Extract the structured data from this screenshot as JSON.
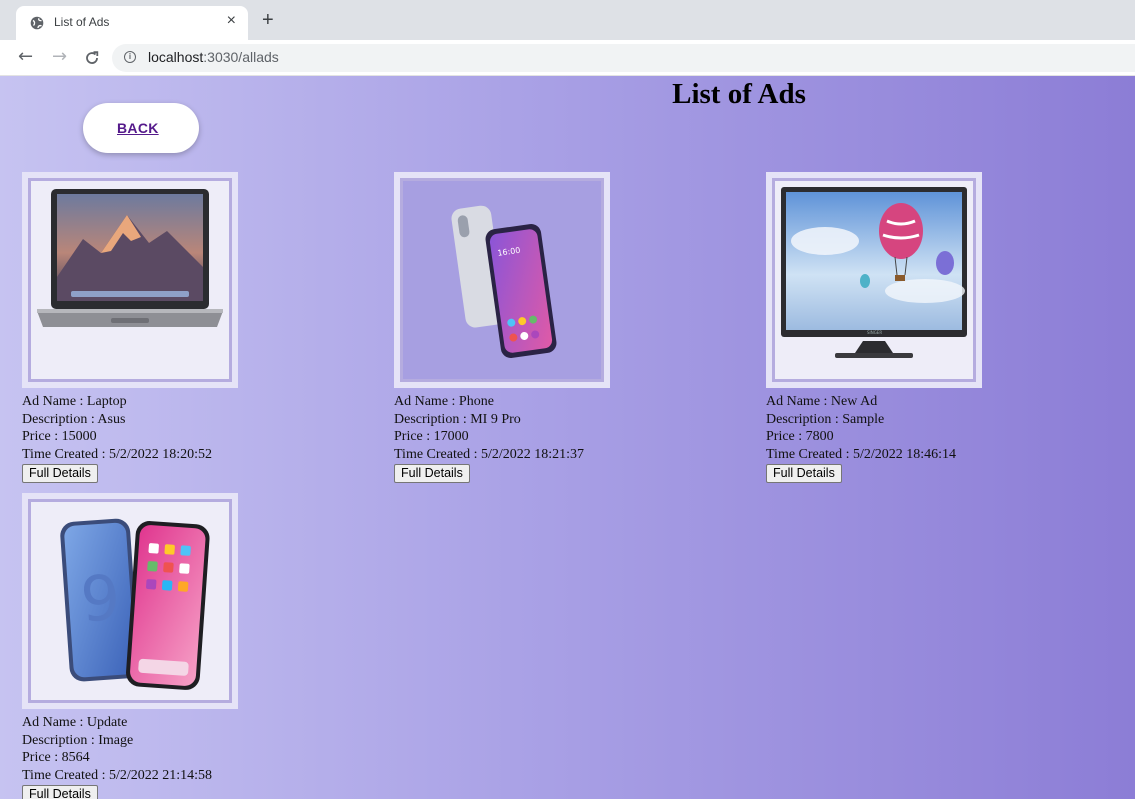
{
  "browser": {
    "tab_title": "List of Ads",
    "url_host": "localhost",
    "url_path": ":3030/allads"
  },
  "page": {
    "title": "List of Ads",
    "back_label": "BACK",
    "button_label": "Full Details"
  },
  "ads": [
    {
      "name": "Ad Name : Laptop",
      "description": "Description : Asus",
      "price": "Price : 15000",
      "time": "Time Created : 5/2/2022 18:20:52",
      "image": "laptop-image"
    },
    {
      "name": "Ad Name : Phone",
      "description": "Description : MI 9 Pro",
      "price": "Price : 17000",
      "time": "Time Created : 5/2/2022 18:21:37",
      "image": "phone-image"
    },
    {
      "name": "Ad Name : New Ad",
      "description": "Description : Sample",
      "price": "Price : 7800",
      "time": "Time Created : 5/2/2022 18:46:14",
      "image": "tv-image"
    },
    {
      "name": "Ad Name : Update",
      "description": "Description : Image",
      "price": "Price : 8564",
      "time": "Time Created : 5/2/2022 21:14:58",
      "image": "phones-image"
    }
  ],
  "colors": {
    "gradient_start": "#c6c3f1",
    "gradient_end": "#8c7dd6",
    "link": "#551a8b"
  }
}
